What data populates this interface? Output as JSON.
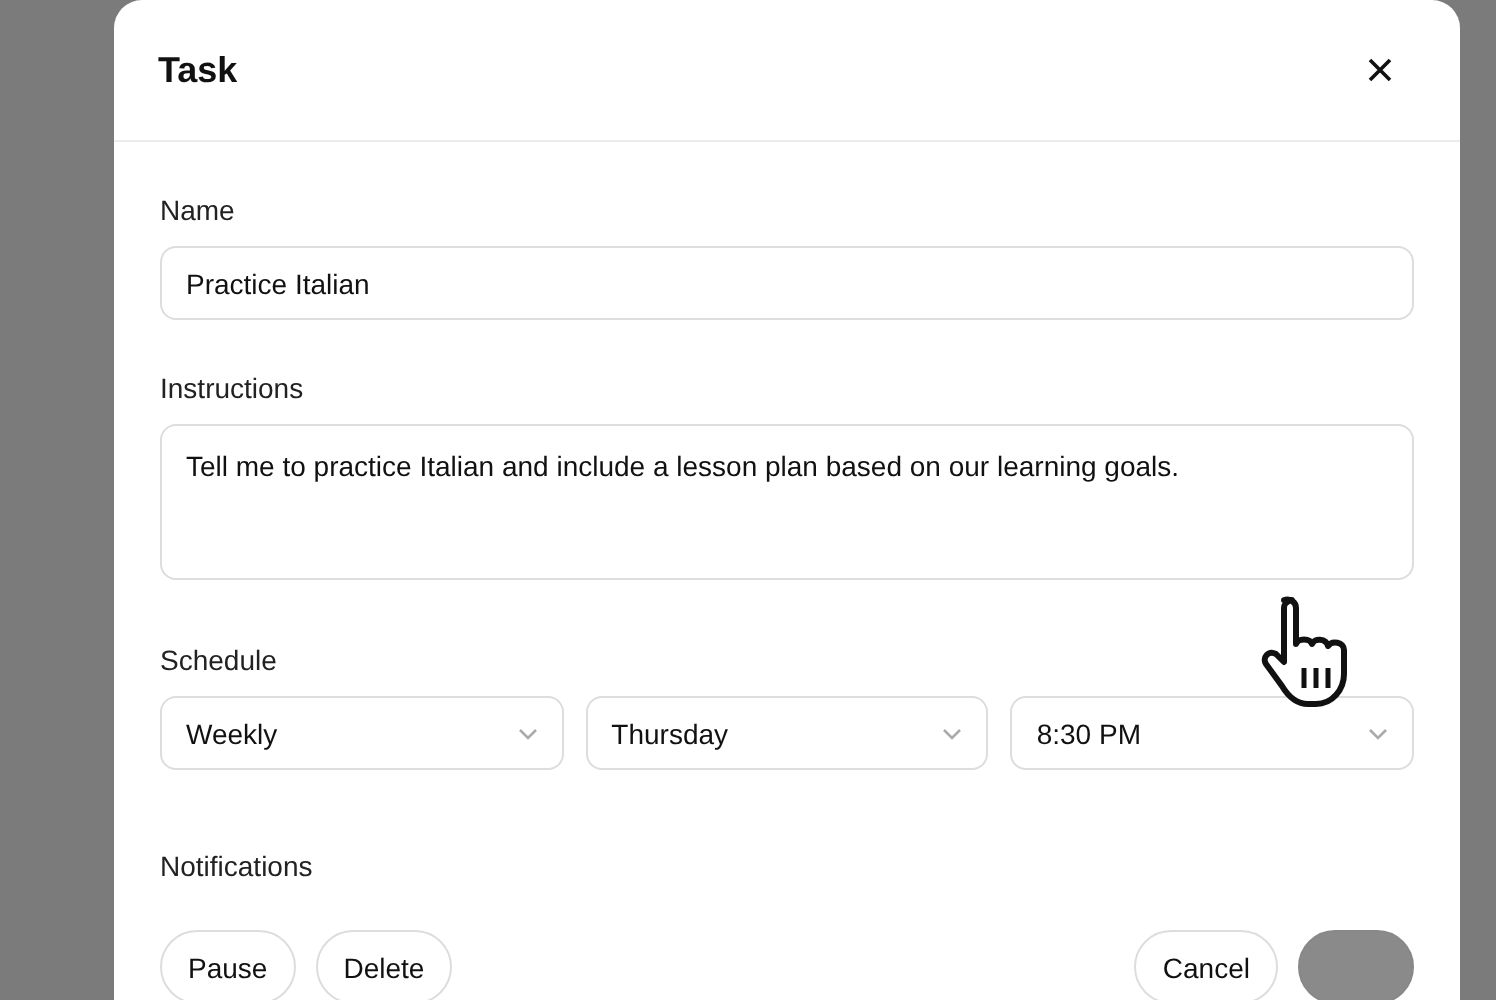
{
  "dialog": {
    "title": "Task"
  },
  "fields": [
    {
      "kind": "text",
      "label": "Name",
      "value": "Practice Italian"
    },
    {
      "kind": "textarea",
      "label": "Instructions",
      "value": "Tell me to practice Italian and include a lesson plan based on our learning goals."
    }
  ],
  "schedule": {
    "label": "Schedule",
    "selects": [
      "Weekly",
      "Thursday",
      "8:30 PM"
    ]
  },
  "notifications": {
    "label": "Notifications"
  },
  "buttons": [
    {
      "label": "Pause",
      "kind": "secondary"
    },
    {
      "label": "Delete",
      "kind": "secondary"
    },
    {
      "label": "Cancel",
      "kind": "secondary"
    },
    {
      "kind": "primary"
    }
  ]
}
